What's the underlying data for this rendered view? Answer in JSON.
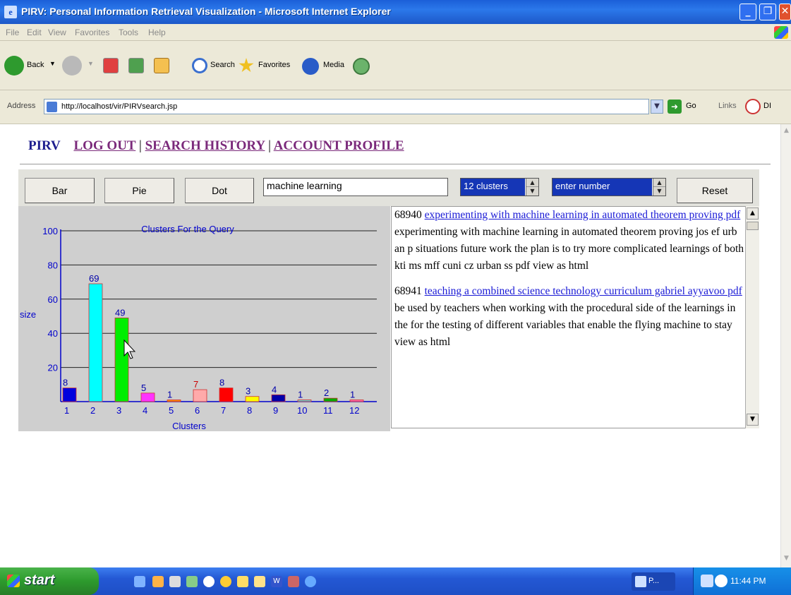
{
  "window": {
    "title": "PIRV: Personal Information Retrieval Visualization - Microsoft Internet Explorer",
    "icon": "ie-icon"
  },
  "menu": [
    "File",
    "Edit",
    "View",
    "Favorites",
    "Tools",
    "Help"
  ],
  "toolbar": {
    "back_label": "Back",
    "search_label": "Search",
    "favorites_label": "Favorites",
    "media_label": "Media"
  },
  "address": {
    "label": "Address",
    "url": "http://localhost/vir/PIRVsearch.jsp",
    "go_label": "Go",
    "links_label": "Links",
    "links_item": "DI"
  },
  "nav": {
    "brand": "PIRV",
    "links": [
      "LOG OUT",
      "SEARCH HISTORY",
      "ACCOUNT PROFILE"
    ],
    "separator": "|"
  },
  "controls": {
    "buttons": [
      "Bar",
      "Pie",
      "Dot"
    ],
    "query": "machine learning",
    "clusters": "12 clusters",
    "number_placeholder": "enter number",
    "reset_label": "Reset"
  },
  "chart_data": {
    "type": "bar",
    "title": "Clusters For the Query",
    "xlabel": "Clusters",
    "ylabel": "size",
    "ylim": [
      0,
      100
    ],
    "yticks": [
      20,
      40,
      60,
      80,
      100
    ],
    "categories": [
      "1",
      "2",
      "3",
      "4",
      "5",
      "6",
      "7",
      "8",
      "9",
      "10",
      "11",
      "12"
    ],
    "values": [
      8,
      69,
      49,
      5,
      1,
      7,
      8,
      3,
      4,
      1,
      2,
      1
    ],
    "colors": [
      "#0000dd",
      "#00ffff",
      "#00ee00",
      "#ff33ff",
      "#ff8800",
      "#ffaaaa",
      "#ff0000",
      "#ffff00",
      "#0000aa",
      "#66cccc",
      "#00aa00",
      "#ff66aa"
    ],
    "label_colors": [
      "#0000aa",
      "#0000aa",
      "#0000aa",
      "#0000aa",
      "#0000aa",
      "#cc0000",
      "#0000aa",
      "#0000aa",
      "#0000aa",
      "#0000aa",
      "#0000aa",
      "#0000aa"
    ],
    "grid": true,
    "text_color": "#0000cc"
  },
  "results": [
    {
      "id": "68940",
      "link": "experimenting with machine learning in automated theorem proving   pdf",
      "snippet": "experimenting with machine learning in automated theorem proving jos ef urb an p situations future work the plan is to try more complicated learnings of both kti ms mff cuni cz urban ss pdf   view as html"
    },
    {
      "id": "68941",
      "link": "teaching a combined science technology curriculum gabriel ayyavoo   pdf",
      "snippet": "be used by teachers when working with the procedural side of the learnings in the for the testing of different variables that enable the flying machine to stay view as html"
    }
  ],
  "taskbar": {
    "start_label": "start",
    "task_label": "P...",
    "clock": "11:44 PM"
  }
}
